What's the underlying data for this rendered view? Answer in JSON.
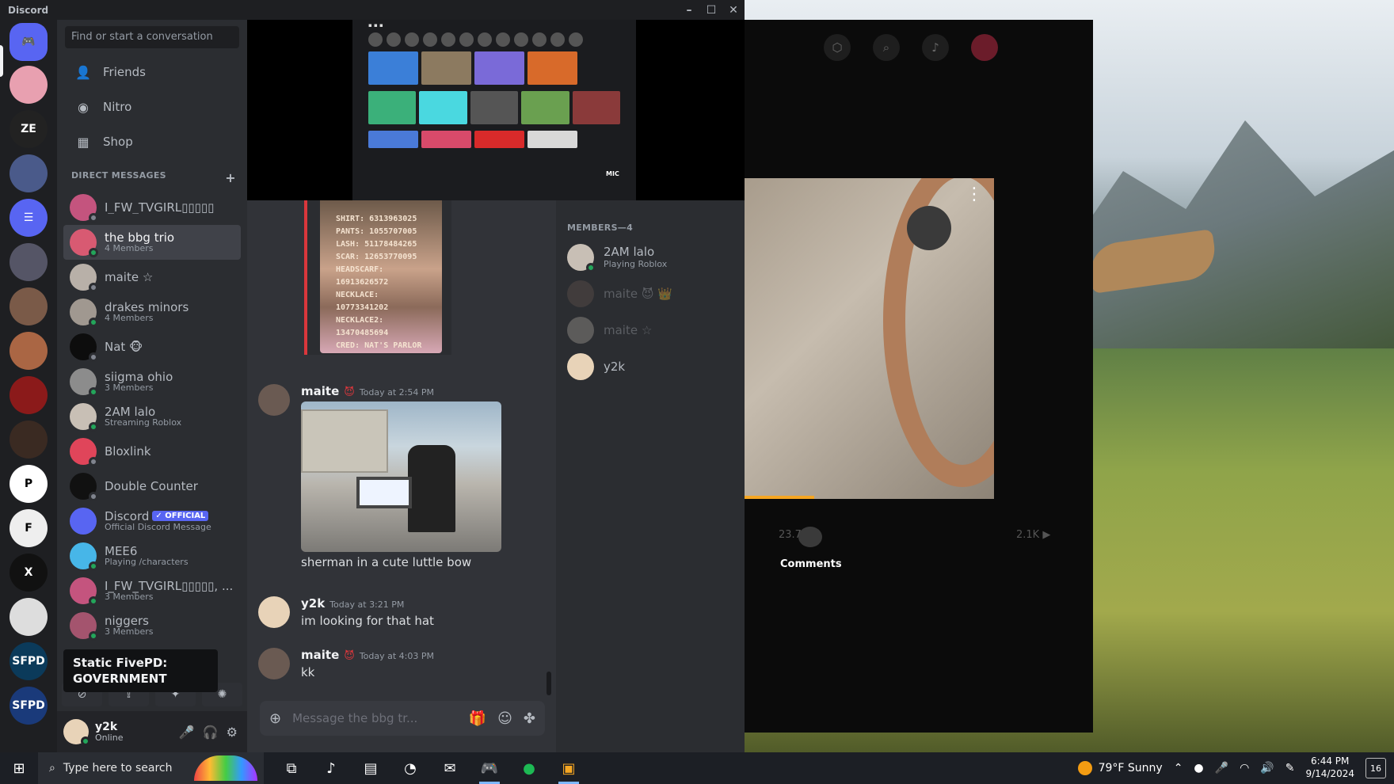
{
  "window": {
    "title": "Discord",
    "minimize": "–",
    "maximize": "☐",
    "close": "✕"
  },
  "search": {
    "placeholder": "Find or start a conversation"
  },
  "nav": [
    {
      "label": "Friends",
      "icon": "friends-icon"
    },
    {
      "label": "Nitro",
      "icon": "nitro-icon"
    },
    {
      "label": "Shop",
      "icon": "shop-icon"
    }
  ],
  "dm_header": {
    "label": "DIRECT MESSAGES",
    "add": "+"
  },
  "dms": [
    {
      "name": "I_FW_TVGIRL▯▯▯▯▯",
      "sub": "",
      "avatar": "#c4547e",
      "status": "#80848e"
    },
    {
      "name": "the bbg trio",
      "sub": "4 Members",
      "avatar": "#d85a72",
      "status": "#23a55a"
    },
    {
      "name": "maite ☆",
      "sub": "",
      "avatar": "#b8b0a8",
      "status": "#80848e"
    },
    {
      "name": "drakes minors",
      "sub": "4 Members",
      "avatar": "#a09890",
      "status": "#23a55a"
    },
    {
      "name": "Nat 🐵",
      "sub": "",
      "avatar": "#0d0d0d",
      "status": "#80848e"
    },
    {
      "name": "siigma ohio",
      "sub": "3 Members",
      "avatar": "#8c8c8c",
      "status": "#23a55a"
    },
    {
      "name": "2AM lalo",
      "sub": "Streaming Roblox",
      "avatar": "#c8bfb5",
      "status": "#23a55a"
    },
    {
      "name": "Bloxlink",
      "sub": "",
      "avatar": "#e0455a",
      "status": "#80848e"
    },
    {
      "name": "Double Counter",
      "sub": "",
      "avatar": "#111111",
      "status": "#80848e"
    },
    {
      "name": "Discord",
      "sub": "Official Discord Message",
      "avatar": "#5865f2",
      "status": "",
      "badge": "✓ OFFICIAL"
    },
    {
      "name": "MEE6",
      "sub": "Playing /characters",
      "avatar": "#47b6e8",
      "status": "#23a55a"
    },
    {
      "name": "I_FW_TVGIRL▯▯▯▯▯, ...",
      "sub": "3 Members",
      "avatar": "#c4547e",
      "status": "#23a55a"
    },
    {
      "name": "niggers",
      "sub": "3 Members",
      "avatar": "#a4546e",
      "status": "#23a55a"
    }
  ],
  "tooltip": {
    "text": "Static FivePD: GOVERNMENT"
  },
  "user": {
    "name": "y2k",
    "status": "Online"
  },
  "stream": {
    "mic_label": "MIC"
  },
  "messages": [
    {
      "author": "maite",
      "emoji": "😈",
      "time": "Today at 2:54 PM",
      "text": "sherman in a cute luttle bow"
    },
    {
      "author": "y2k",
      "emoji": "",
      "time": "Today at 3:21 PM",
      "text": "im looking for that hat"
    },
    {
      "author": "maite",
      "emoji": "😈",
      "time": "Today at 4:03 PM",
      "text": "kk"
    }
  ],
  "image_post": {
    "lines": [
      "SHIRT: 6313963025",
      "PANTS: 1055707005",
      "LASH: 51178484265",
      "SCAR: 12653770095",
      "HEADSCARF: 16913626572",
      "NECKLACE: 10773341202",
      "NECKLACE2: 13470485694",
      "CRED: NAT'S PARLOR"
    ]
  },
  "composer": {
    "placeholder": "Message the bbg tr..."
  },
  "members": {
    "header": "MEMBERS—4",
    "list": [
      {
        "name": "2AM lalo",
        "sub": "Playing Roblox",
        "avatar": "#c8bfb5",
        "status": "#23a55a",
        "offline": false
      },
      {
        "name": "maite 😈 👑",
        "sub": "",
        "avatar": "#6a5a52",
        "status": "",
        "offline": true
      },
      {
        "name": "maite ☆",
        "sub": "",
        "avatar": "#b8b0a8",
        "status": "",
        "offline": true
      },
      {
        "name": "y2k",
        "sub": "",
        "avatar": "#e8d3b8",
        "status": "",
        "offline": false
      }
    ]
  },
  "video": {
    "comments_label": "Comments",
    "stat_left": "23.7K",
    "stat_right": "2.1K ▶",
    "progress": 0.28
  },
  "taskbar": {
    "search_placeholder": "Type here to search",
    "weather": "79°F  Sunny",
    "time": "6:44 PM",
    "date": "9/14/2024",
    "notifications": "16"
  }
}
